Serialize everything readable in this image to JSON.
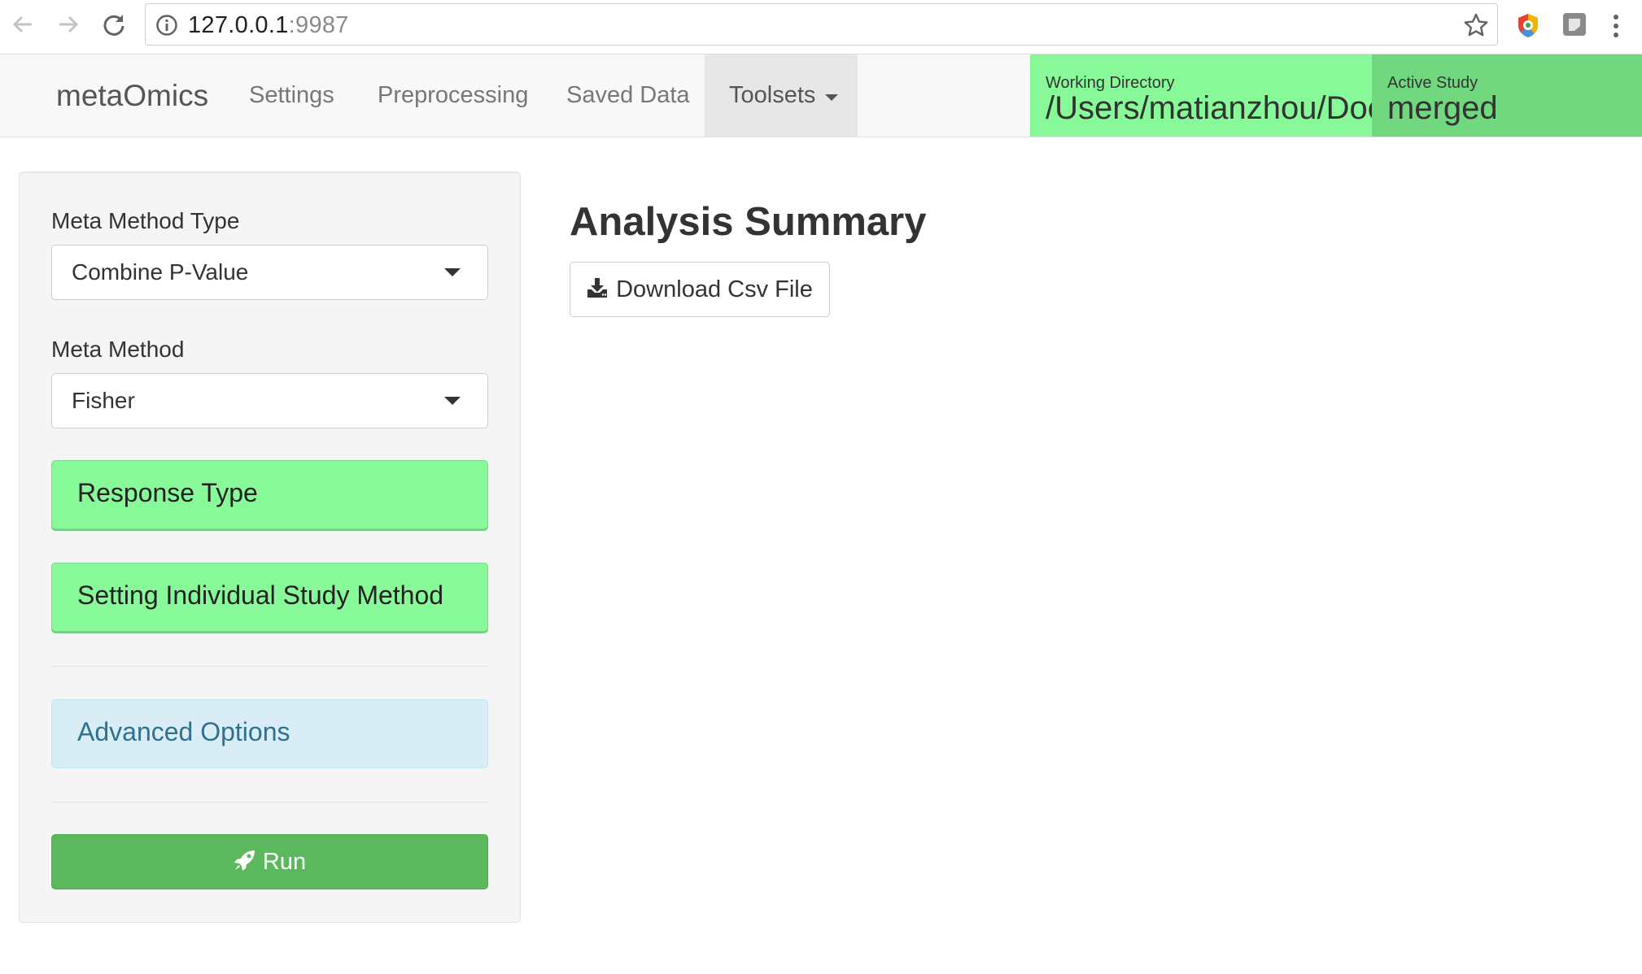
{
  "browser": {
    "url_host": "127.0.0.1",
    "url_port": ":9987",
    "icons": [
      "back-arrow-icon",
      "forward-arrow-icon",
      "reload-icon",
      "info-icon",
      "star-icon",
      "extension-icon",
      "menu-icon"
    ]
  },
  "navbar": {
    "brand": "metaOmics",
    "items": [
      {
        "label": "Settings"
      },
      {
        "label": "Preprocessing"
      },
      {
        "label": "Saved Data"
      },
      {
        "label": "Toolsets"
      }
    ],
    "working_directory": {
      "label": "Working Directory",
      "value": "/Users/matianzhou/Documents"
    },
    "active_study": {
      "label": "Active Study",
      "value": "merged"
    }
  },
  "sidebar": {
    "meta_method_type": {
      "label": "Meta Method Type",
      "value": "Combine P-Value"
    },
    "meta_method": {
      "label": "Meta Method",
      "value": "Fisher"
    },
    "response_type_label": "Response Type",
    "individual_study_label": "Setting Individual Study Method",
    "advanced_options_label": "Advanced Options",
    "run_label": "Run"
  },
  "main": {
    "title": "Analysis Summary",
    "download_label": "Download Csv File"
  },
  "colors": {
    "working_dir_bg": "#88f998",
    "active_study_bg": "#72d880",
    "green_button": "#88f998",
    "info_button": "#d9edf7",
    "run_button": "#5cb85c"
  }
}
